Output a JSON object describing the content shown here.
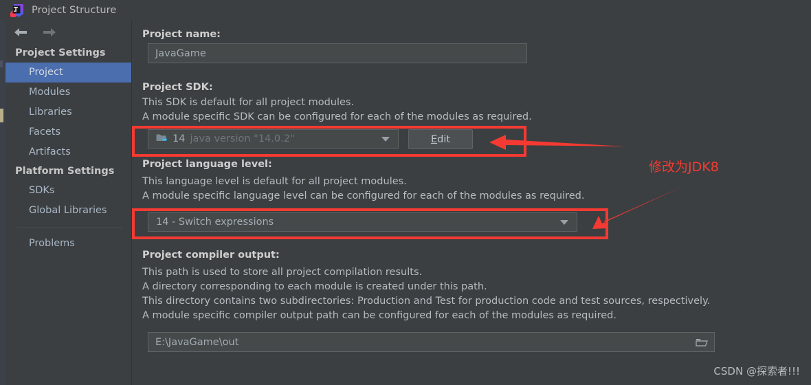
{
  "window": {
    "title": "Project Structure",
    "app_icon": "intellij-idea-icon"
  },
  "nav": {
    "back_icon": "arrow-left-icon",
    "forward_icon": "arrow-right-icon"
  },
  "sidebar": {
    "groups": [
      {
        "title": "Project Settings",
        "items": [
          {
            "label": "Project",
            "selected": true
          },
          {
            "label": "Modules",
            "selected": false
          },
          {
            "label": "Libraries",
            "selected": false
          },
          {
            "label": "Facets",
            "selected": false
          },
          {
            "label": "Artifacts",
            "selected": false
          }
        ]
      },
      {
        "title": "Platform Settings",
        "items": [
          {
            "label": "SDKs",
            "selected": false
          },
          {
            "label": "Global Libraries",
            "selected": false
          }
        ]
      }
    ],
    "problems_label": "Problems"
  },
  "main": {
    "project_name": {
      "label": "Project name:",
      "value": "JavaGame"
    },
    "project_sdk": {
      "label": "Project SDK:",
      "desc_line1": "This SDK is default for all project modules.",
      "desc_line2": "A module specific SDK can be configured for each of the modules as required.",
      "selected_value": "14",
      "selected_detail": "java version \"14.0.2\"",
      "icon": "java-sdk-folder-icon",
      "dropdown_icon": "chevron-down-icon",
      "edit_button": {
        "mnemonic": "E",
        "rest": "dit"
      }
    },
    "language_level": {
      "label": "Project language level:",
      "desc_line1": "This language level is default for all project modules.",
      "desc_line2": "A module specific language level can be configured for each of the modules as required.",
      "selected_value": "14 - Switch expressions",
      "dropdown_icon": "chevron-down-icon"
    },
    "compiler_output": {
      "label": "Project compiler output:",
      "desc_line1": "This path is used to store all project compilation results.",
      "desc_line2": "A directory corresponding to each module is created under this path.",
      "desc_line3": "This directory contains two subdirectories: Production and Test for production code and test sources, respectively.",
      "desc_line4": "A module specific compiler output path can be configured for each of the modules as required.",
      "value": "E:\\JavaGame\\out",
      "browse_icon": "folder-open-icon"
    }
  },
  "annotations": {
    "note_text": "修改为JDK8",
    "accent_color": "#f43a32",
    "sdk_highlight_name": "sdk-row-highlight",
    "language_highlight_name": "language-level-highlight",
    "arrow_sdk_name": "arrow-to-sdk",
    "arrow_language_name": "arrow-to-language-level"
  },
  "watermark": {
    "text": "CSDN @探索者!!!"
  },
  "colors": {
    "background": "#3c3f41",
    "field_bg": "#45494a",
    "selection_blue": "#4b6eaf",
    "text": "#b6bcc2",
    "annotation_red": "#f43a32"
  }
}
